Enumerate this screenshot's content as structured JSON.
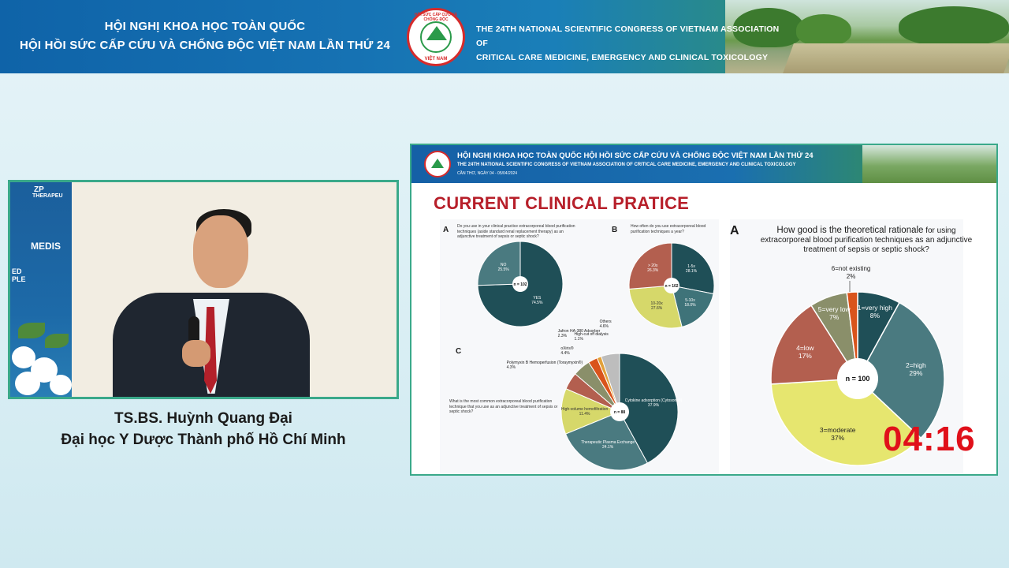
{
  "banner": {
    "title_vn_line1": "HỘI NGHỊ KHOA HỌC TOÀN QUỐC",
    "title_vn_line2": "HỘI HỒI SỨC CẤP CỨU VÀ CHỐNG ĐỘC VIỆT NAM LẦN THỨ 24",
    "title_en_line1": "THE 24TH NATIONAL SCIENTIFIC CONGRESS OF VIETNAM ASSOCIATION OF",
    "title_en_line2": "CRITICAL CARE MEDICINE, EMERGENCY AND CLINICAL TOXICOLOGY",
    "logo_ring_top": "HỒI SỨC CẤP CỨU VÀ CHỐNG ĐỘC",
    "logo_ring_bottom": "VIỆT NAM",
    "logo_center": "ASSOCIATION",
    "colors": {
      "primary": "#1672b3",
      "accent": "#3aa98a"
    }
  },
  "speaker": {
    "name": "TS.BS. Huỳnh Quang Đại",
    "affiliation": "Đại học Y Dược Thành phố Hồ Chí Minh",
    "backdrop_text_1": "ZP",
    "backdrop_text_2": "THERAPEU",
    "backdrop_text_3": "MEDIS",
    "backdrop_text_4": "ED",
    "backdrop_text_5": "PLE"
  },
  "slide": {
    "header_vn": "HỘI NGHỊ KHOA HỌC TOÀN QUỐC HỘI HỒI SỨC CẤP CỨU VÀ CHỐNG ĐỘC VIỆT NAM LẦN THỨ 24",
    "header_en": "THE 24TH NATIONAL SCIENTIFIC CONGRESS OF VIETNAM ASSOCIATION OF CRITICAL CARE MEDICINE, EMERGENCY AND CLINICAL TOXICOLOGY",
    "header_date": "CẦN THƠ, NGÀY 04 - 05/04/2024",
    "title": "CURRENT CLINICAL PRATICE",
    "panel_a_letter": "A",
    "panel_a_question": "Do you use in your clinical practice extracorporeal blood purification techniques (aside standard renal replacement therapy) as an adjunctive treatment of sepsis or septic shock?",
    "panel_b_letter": "B",
    "panel_b_question": "How often do you use extracorporeal blood purification techniques a year?",
    "panel_c_letter": "C",
    "panel_c_question": "What is the most common extracorporeal blood purification technique that you use as an adjunctive treatment of sepsis or septic shock?",
    "panel_d_letter": "A",
    "big_question_lead": "How good is the theoretical rationale",
    "big_question_rest": "for using extracorporeal blood purification techniques as an adjunctive treatment of sepsis or septic shock?"
  },
  "timer": {
    "value": "04:16",
    "color": "#e0101a"
  },
  "chart_data": [
    {
      "type": "pie",
      "id": "panel-a",
      "center_label": "n = 102",
      "slices": [
        {
          "label": "YES",
          "value": "74.5",
          "color": "#1f4f57"
        },
        {
          "label": "NO",
          "value": "25.5",
          "color": "#4a7a80"
        }
      ]
    },
    {
      "type": "pie",
      "id": "panel-b",
      "center_label": "n = 102",
      "slices": [
        {
          "label": "1-5x",
          "value": "28.1",
          "color": "#1f4f57"
        },
        {
          "label": "5-10x",
          "value": "18.0",
          "color": "#3f7379"
        },
        {
          "label": "10-20x",
          "value": "27.6",
          "color": "#d6d86a"
        },
        {
          "label": "> 20x",
          "value": "26.3",
          "color": "#b35f4f"
        }
      ]
    },
    {
      "type": "pie",
      "id": "panel-c",
      "center_label": "n = 88",
      "slices": [
        {
          "label": "Cytokine adsorption (Cytosorb®)",
          "value": "37.9",
          "color": "#1f4f57"
        },
        {
          "label": "Therapeutic Plasma Exchange",
          "value": "24.1",
          "color": "#4a7a80"
        },
        {
          "label": "High-volume hemofiltration",
          "value": "11.4",
          "color": "#d6d86a"
        },
        {
          "label": "Polymyxin B Hemoperfusion (Toraymyxin®)",
          "value": "4.3",
          "color": "#b35f4f"
        },
        {
          "label": "oXiris®",
          "value": "4.4",
          "color": "#8a8f6a"
        },
        {
          "label": "Jafron HA-380 Adsorber",
          "value": "2.3",
          "color": "#d9541c"
        },
        {
          "label": "High-cut off dialysis",
          "value": "1.1",
          "color": "#e2a13a"
        },
        {
          "label": "Others",
          "value": "4.6",
          "color": "#bdbdbd"
        }
      ]
    },
    {
      "type": "pie",
      "id": "panel-d",
      "center_label": "n = 100",
      "slices": [
        {
          "label": "1=very high",
          "value": 8,
          "color": "#1f4f57"
        },
        {
          "label": "2=high",
          "value": 29,
          "color": "#4a7a80"
        },
        {
          "label": "3=moderate",
          "value": 37,
          "color": "#e6e66f"
        },
        {
          "label": "4=low",
          "value": 17,
          "color": "#b35f4f"
        },
        {
          "label": "5=very low",
          "value": 7,
          "color": "#8a8f6a"
        },
        {
          "label": "6=not existing",
          "value": 2,
          "color": "#d9541c"
        }
      ]
    }
  ]
}
